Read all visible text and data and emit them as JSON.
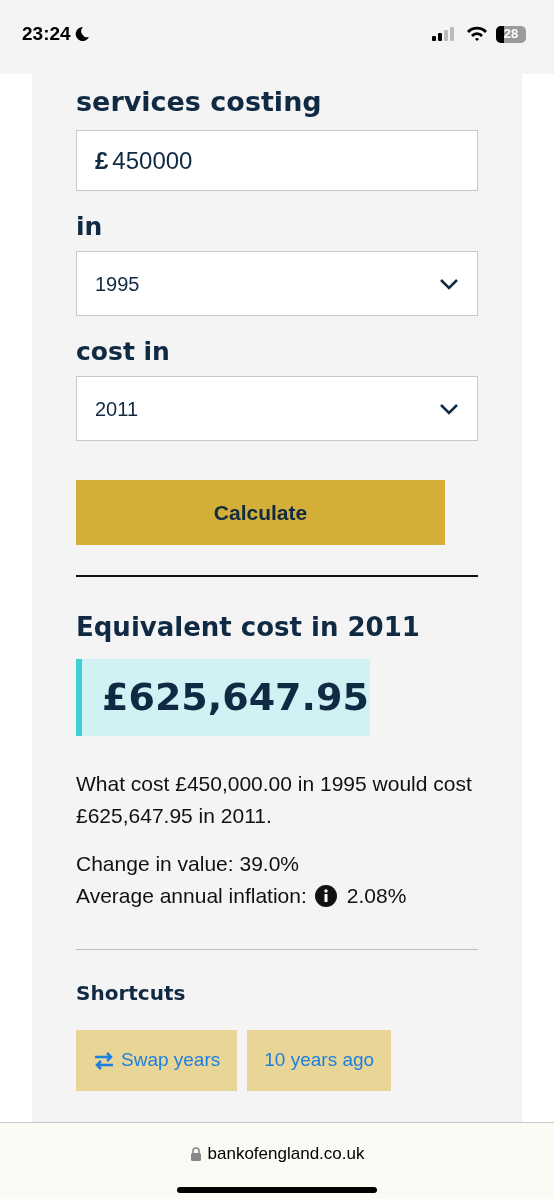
{
  "status_bar": {
    "time": "23:24",
    "battery": "28"
  },
  "form": {
    "heading": "services costing",
    "amount": {
      "currency": "£",
      "value": "450000"
    },
    "fields": [
      {
        "label": "in",
        "value": "1995"
      },
      {
        "label": "cost in",
        "value": "2011"
      }
    ],
    "button": "Calculate"
  },
  "result": {
    "heading": "Equivalent cost in 2011",
    "amount": "£625,647.95",
    "sentence": "What cost £450,000.00 in 1995 would cost £625,647.95 in 2011.",
    "change": "Change in value: 39.0%",
    "inflation_label": "Average annual inflation:",
    "inflation_value": "2.08%"
  },
  "shortcuts": {
    "title": "Shortcuts",
    "items": [
      {
        "label": "Swap years",
        "kind": "swap"
      },
      {
        "label": "10 years ago",
        "kind": "plain"
      }
    ]
  },
  "browser": {
    "url": "bankofengland.co.uk"
  }
}
